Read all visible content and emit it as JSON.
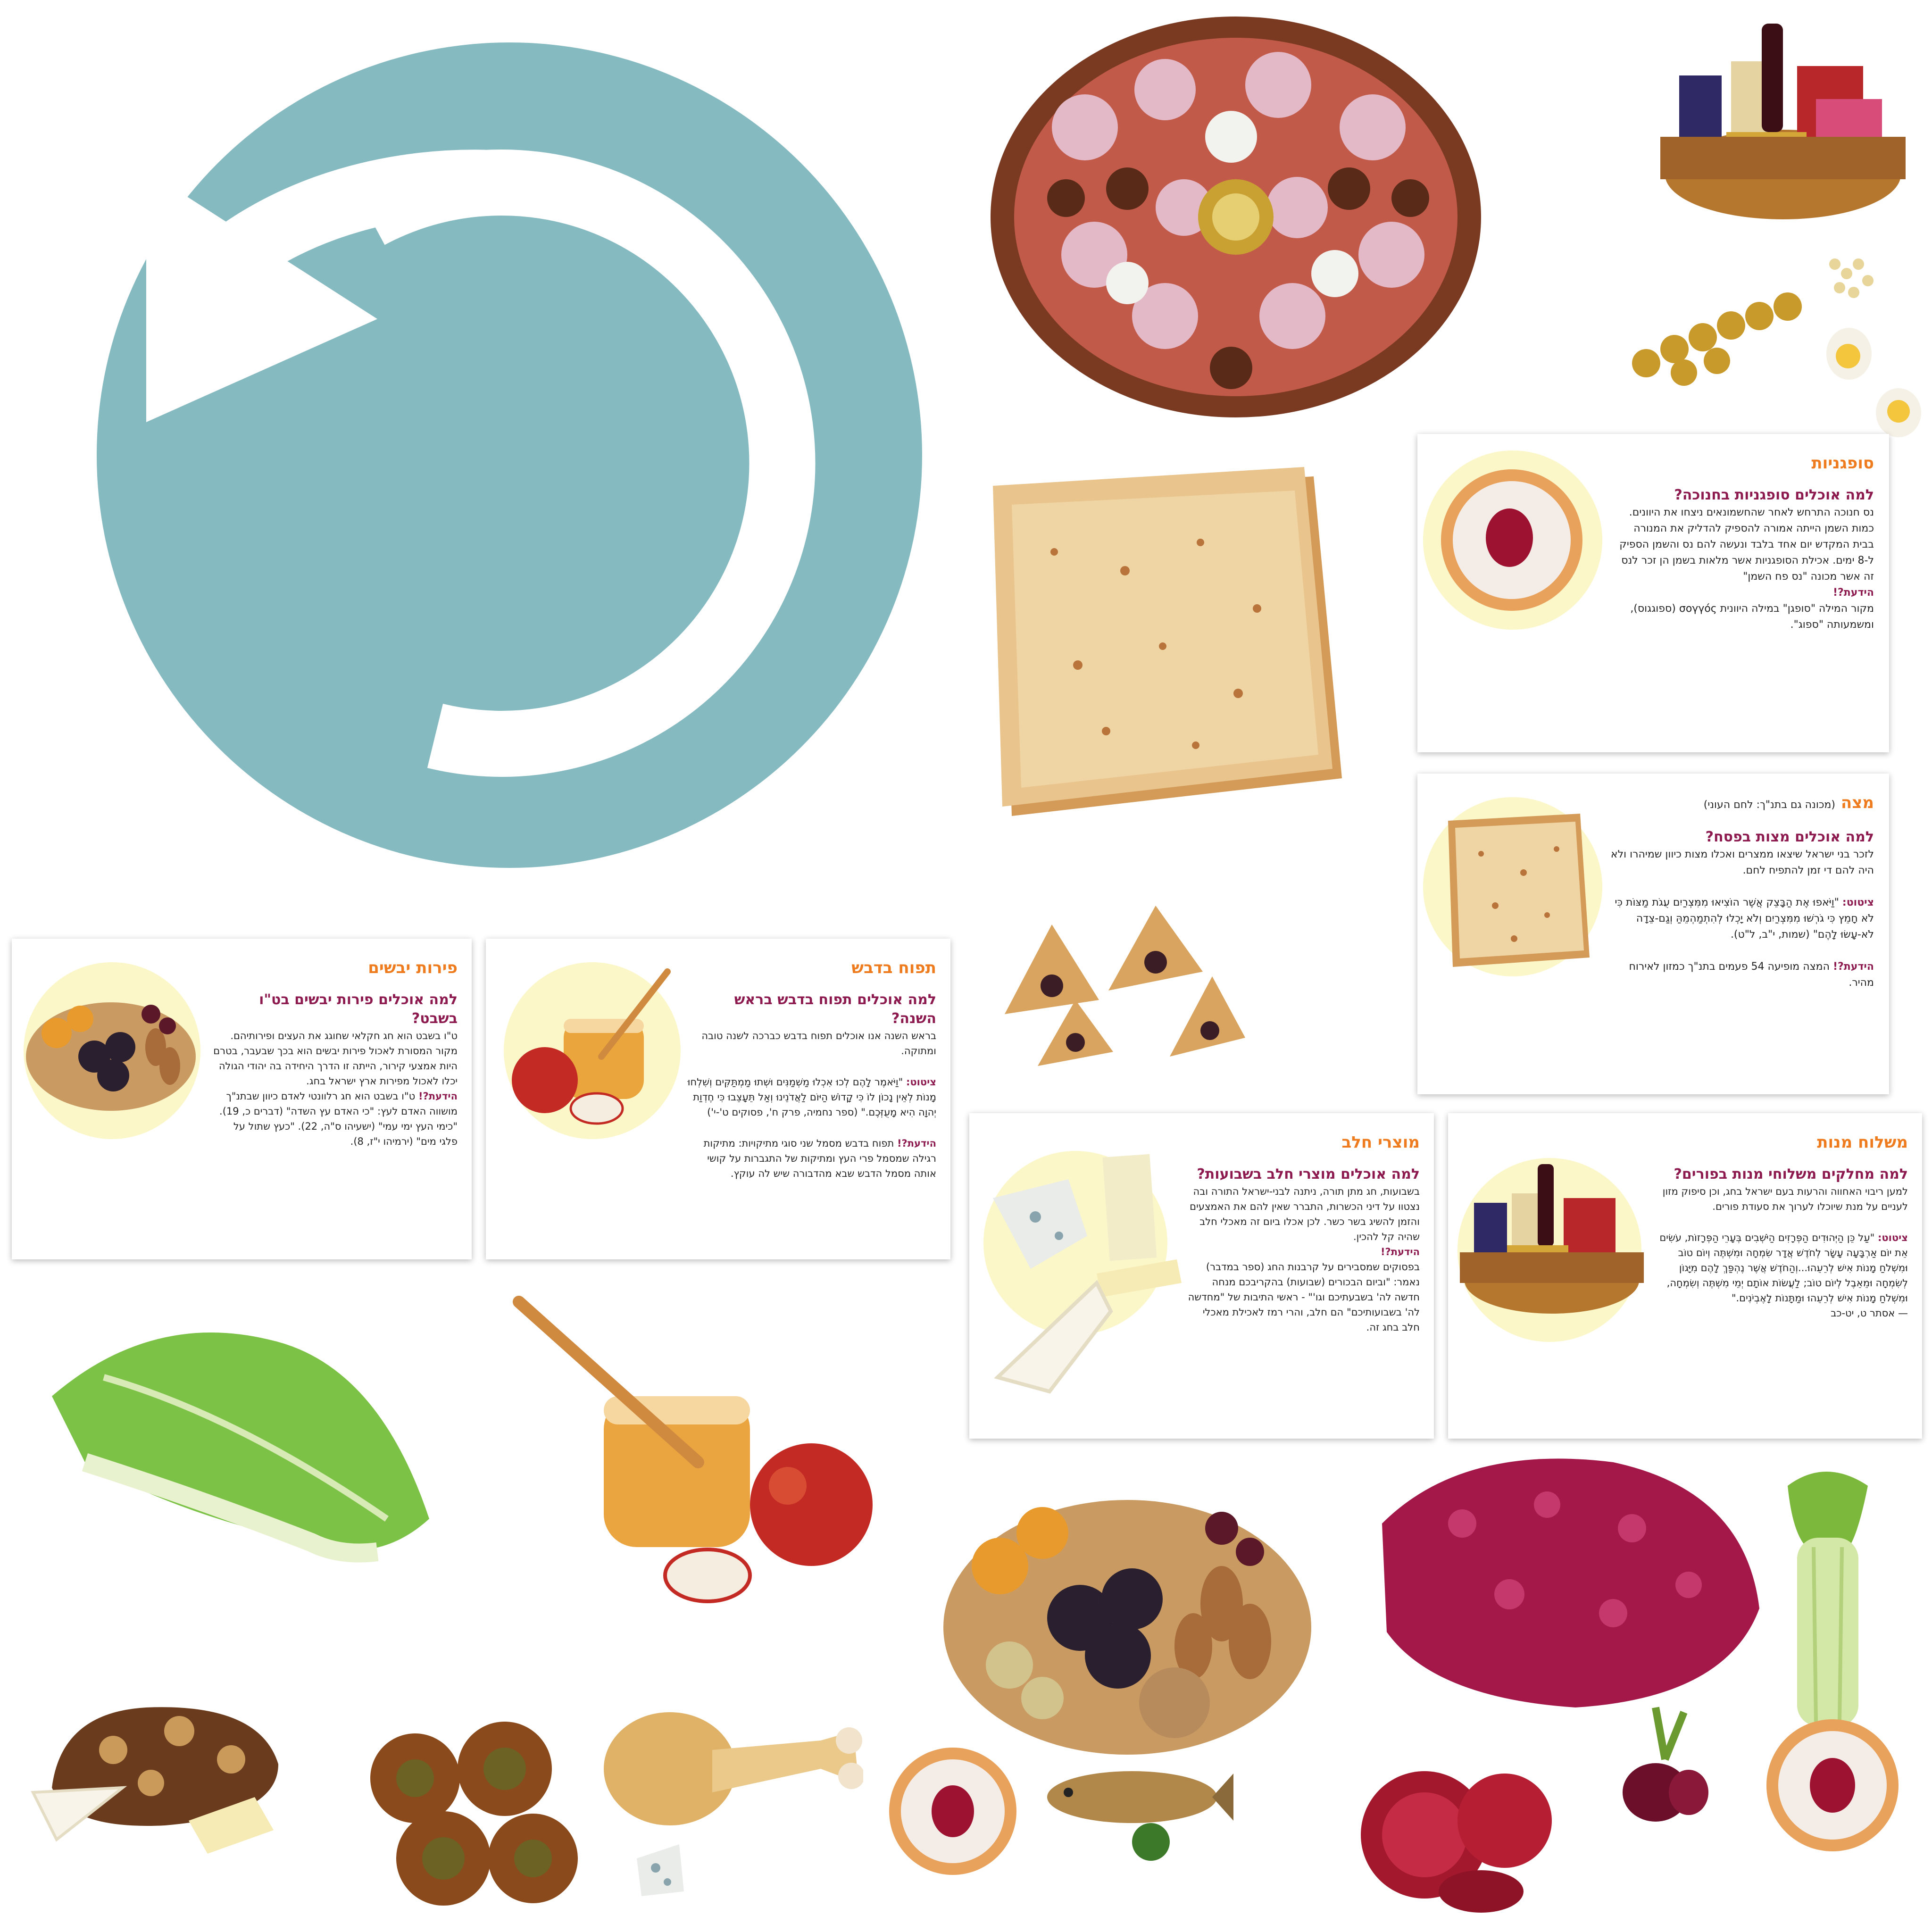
{
  "cards": {
    "sufganiyot": {
      "title": "סופגניות",
      "question": "למה אוכלים סופגניות בחנוכה?",
      "body": "נס חנוכה התרחש לאחר שהחשמונאים ניצחו את היוונים. כמות השמן הייתה אמורה להספיק להדליק את המנורה בבית המקדש יום אחד בלבד ונעשה להם נס והשמן הספיק ל-8 ימים. אכילת הסופגניות אשר מלאות בשמן הן זכר לנס זה אשר מכונה \"נס פח השמן\"",
      "fact_label": "הידעת?!",
      "fact": "מקור המילה \"סופגן\" במילה היוונית σογγός (ספוגגוס), ומשמעותה \"ספוג\"."
    },
    "matza": {
      "title": "מצה",
      "subtitle": "(מכונה גם בתנ\"ך: לחם העוני)",
      "question": "למה אוכלים מצות בפסח?",
      "body": "לזכר בני ישראל שיצאו ממצרים ואכלו מצות כיוון שמיהרו ולא היה להם די זמן להתפיח לחם.",
      "quote_label": "ציטוט:",
      "quote": "\"וַיֹּאפוּ אֶת הַבָּצֵק אֲשֶׁר הוֹצִיאוּ מִמִּצְרַיִם עֻגֹת מַצּוֹת כִּי לֹא חָמֵץ כִּי גֹרְשׁוּ מִמִּצְרַיִם וְלֹא יָכְלוּ לְהִתְמַהְמֵהַּ וְגַם-צֵדָה לֹא-עָשׂוּ לָהֶם\" (שמות, י\"ב, ל\"ט).",
      "fact_label": "הידעת?!",
      "fact": "המצה מופיעה 54 פעמים בתנ\"ך כמזון לאירוח מהיר."
    },
    "dried_fruit": {
      "title": "פירות יבשים",
      "question": "למה אוכלים פירות יבשים בט\"ו בשבט?",
      "body": "ט\"ו בשבט הוא חג חקלאי שחוגג את העצים ופירותיהם. מקור המסורת לאכול פירות יבשים הוא בכך שבעבר, בטרם היות אמצעי קירור, הייתה זו הדרך היחידה בה יהודי הגולה יכלו לאכול מפירות ארץ ישראל בחג.",
      "fact_label": "הידעת?!",
      "fact": "ט\"ו בשבט הוא חג רלוונטי לאדם כיוון שבתנ\"ך מושווה האדם לעץ: \"כי האדם עץ השדה\" (דברים כ, 19). \"כימי העץ ימי עמי\" (ישעיהו ס\"ה, 22). \"כעץ שתול על פלגי מים\" (ירמיהו י\"ז, 8)."
    },
    "apple_honey": {
      "title": "תפוח בדבש",
      "question": "למה אוכלים תפוח בדבש בראש השנה?",
      "body": "בראש השנה אנו אוכלים תפוח בדבש כברכה לשנה טובה ומתוקה.",
      "quote_label": "ציטוט:",
      "quote": "\"וַיֹּאמֶר לָהֶם לְכוּ אִכְלוּ מַשְׁמַנִּים וּשְׁתוּ מַמְתַּקִּים וְשִׁלְחוּ מָנוֹת לְאֵין נָכוֹן לוֹ כִּי קָדוֹשׁ הַיּוֹם לַאֲדֹנֵינוּ וְאַל תֵּעָצֵבוּ כִּי חֶדְוַת יְהוָה הִיא מָעֻזְּכֶם.\" (ספר נחמיה, פרק ח', פסוקים ט'-י')",
      "fact_label": "הידעת?!",
      "fact": "תפוח בדבש מסמל שני סוגי מתיקויות: מתיקות רגילה שמסמל פרי העץ ומתיקות של התגברות על קושי אותה מסמל הדבש שבא מהדבורה שיש לה עוקץ."
    },
    "dairy": {
      "title": "מוצרי חלב",
      "question": "למה אוכלים מוצרי חלב בשבועות?",
      "body": "בשבועות, חג מתן תורה, ניתנה לבני-ישראל התורה ובה נצטוו על דיני הכשרות, התברר שאין להם את האמצעים והזמן להשיג בשר כשר. לכן אכלו ביום זה מאכלי חלב שהיה קל להכין.",
      "fact_label": "הידעת?!",
      "fact": "בפסוקים שמסבירים על קרבנות החג (ספר במדבר) נאמר: \"וביום הבכורים (שבועות) בהקריבכם מנחה חדשה לה' בשבעתיכם וגו'\" - ראשי התיבות של \"מחדשה לה' בשבועותיכם\" הם חלב, והרי רמז לאכילת מאכלי חלב בחג זה."
    },
    "mishloach": {
      "title": "משלוח מנות",
      "question": "למה מחלקים משלוחי מנות בפורים?",
      "body": "למען ריבוי האחווה והרעות בעם ישראל בחג, וכן סיפוק מזון לעניים על מנת שיוכלו לערוך את סעודת פורים.",
      "quote_label": "ציטוט:",
      "quote": "\"עַל כֵּן הַיְּהוּדִים הַפְּרָזִים הַיֹּשְׁבִים בְּעָרֵי הַפְּרָזוֹת, עֹשִׂים אֵת יוֹם אַרְבָּעָה עָשָׂר לְחֹדֶשׁ אֲדָר שִׂמְחָה וּמִשְׁתֶּה וְיוֹם טוֹב וּמִשְׁלֹחַ מָנוֹת אִישׁ לְרֵעֵהוּ...וְהַחֹדֶשׁ אֲשֶׁר נֶהְפַּךְ לָהֶם מִיָּגוֹן לְשִׂמְחָה וּמֵאֵבֶל לְיוֹם טוֹב; לַעֲשׂוֹת אוֹתָם יְמֵי מִשְׁתֶּה וְשִׂמְחָה, וּמִשְׁלֹחַ מָנוֹת אִישׁ לְרֵעֵהוּ וּמַתָּנוֹת לָאֶבְיֹנִים.\"",
      "source": "— אסתר ט, יט-כב"
    }
  },
  "colors": {
    "refresh_icon": "#86bac1",
    "card_title": "#ee7c1f",
    "card_question": "#8c1a4f",
    "card_circle": "#fbf7c9"
  },
  "icons": {
    "refresh": "refresh-icon"
  }
}
